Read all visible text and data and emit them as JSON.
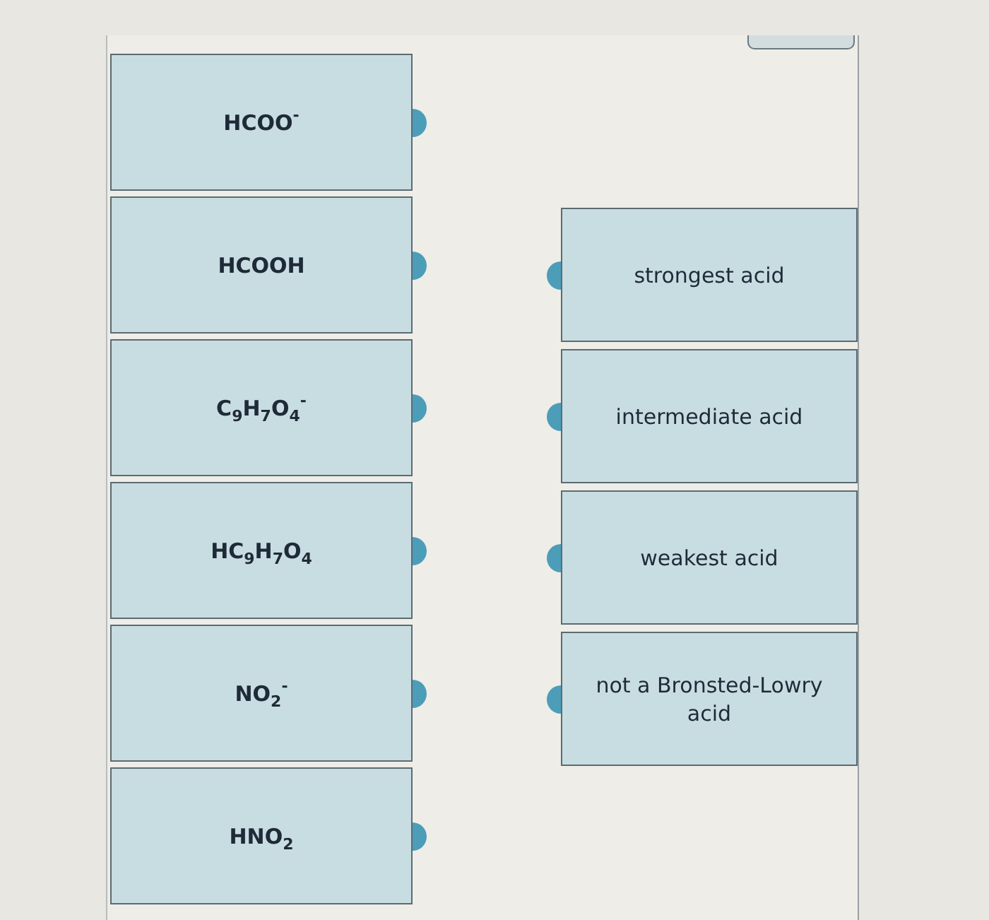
{
  "formulas": [
    {
      "label": "HCOO$^{-}$"
    },
    {
      "label": "HCOOH"
    },
    {
      "label": "C$_{9}$H$_{7}$O$_{4}$$^{-}$"
    },
    {
      "label": "HC$_{9}$H$_{7}$O$_{4}$"
    },
    {
      "label": "NO$_{2}$$^{-}$"
    },
    {
      "label": "HNO$_{2}$"
    }
  ],
  "categories": [
    {
      "label": "strongest acid"
    },
    {
      "label": "intermediate acid"
    },
    {
      "label": "weakest acid"
    },
    {
      "label": "not a Bronsted-Lowry acid"
    }
  ]
}
